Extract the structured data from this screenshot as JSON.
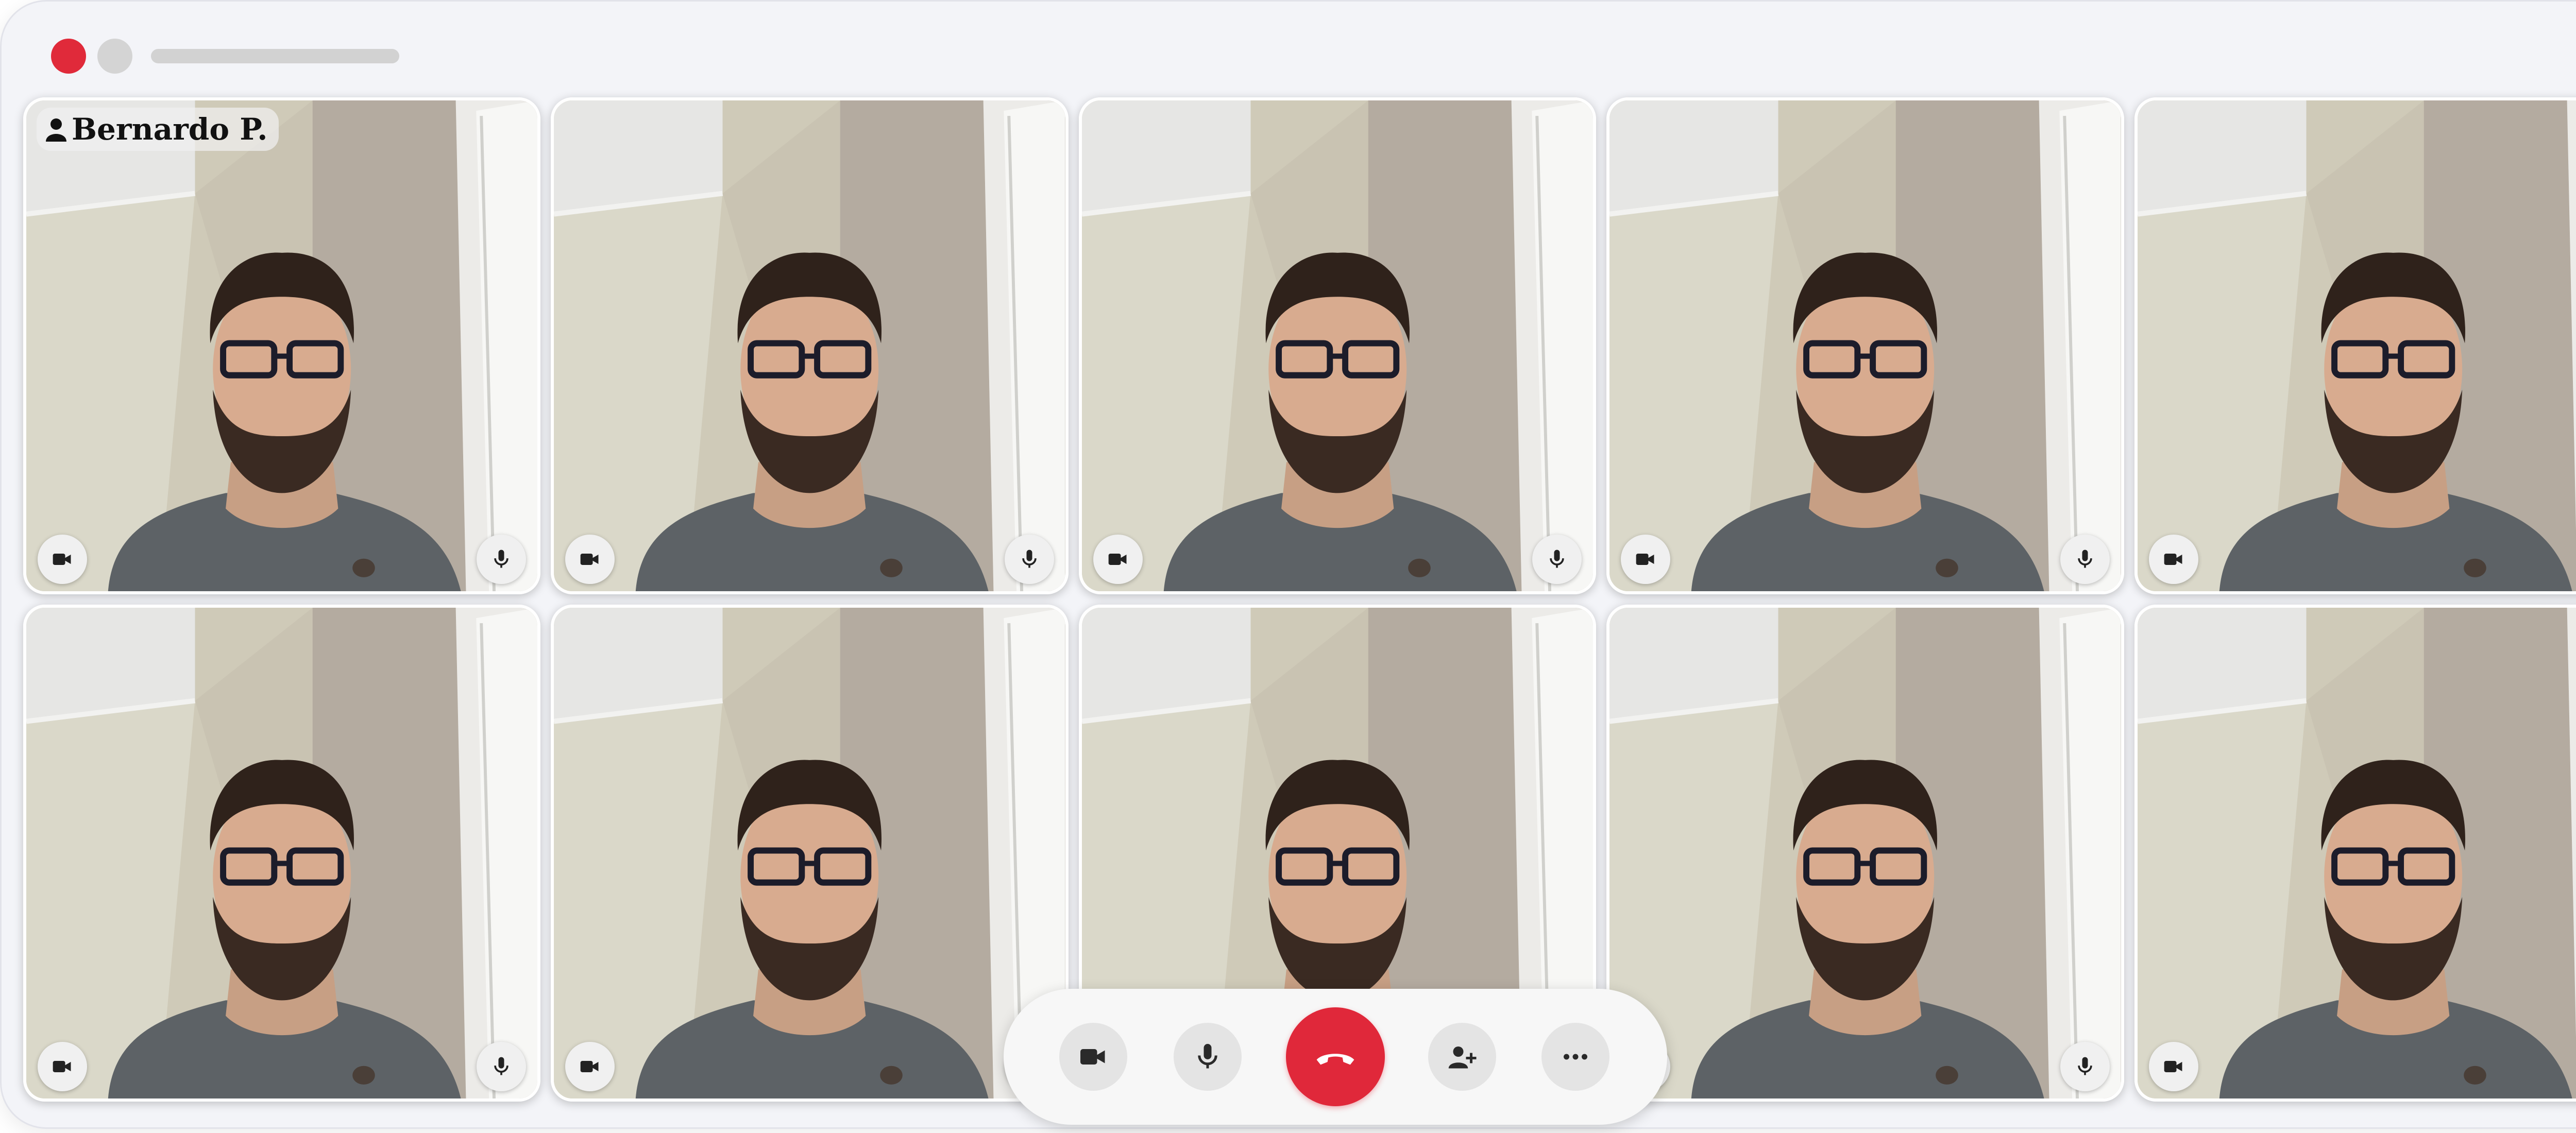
{
  "window": {
    "title": ""
  },
  "participants": [
    {
      "name": "Bernardo P."
    },
    {
      "name": ""
    },
    {
      "name": ""
    },
    {
      "name": ""
    },
    {
      "name": ""
    },
    {
      "name": ""
    },
    {
      "name": ""
    },
    {
      "name": ""
    },
    {
      "name": ""
    },
    {
      "name": ""
    }
  ],
  "tile_controls": {
    "left_icon": "video-camera-icon",
    "right_icon": "microphone-icon"
  },
  "controls": [
    {
      "icon": "video-camera-icon",
      "color": "#2a2a2a"
    },
    {
      "icon": "microphone-icon",
      "color": "#2a2a2a"
    },
    {
      "icon": "hang-up-phone-icon",
      "color": "#e0283a"
    },
    {
      "icon": "add-person-icon",
      "color": "#2a2a2a"
    },
    {
      "icon": "more-options-icon",
      "color": "#2a2a2a"
    }
  ],
  "colors": {
    "accent": "#e0283a",
    "window_bg": "#f3f4f8",
    "tile_button_bg": "#f0f0f0"
  }
}
